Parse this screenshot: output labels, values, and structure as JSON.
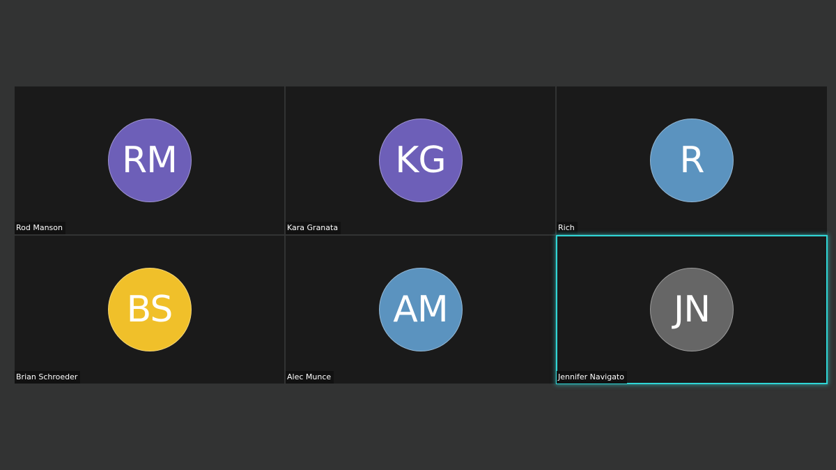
{
  "meeting": {
    "active_speaker_color": "#2fd6d6",
    "background_color": "#323333",
    "participants": [
      {
        "name": "Rod Manson",
        "initials": "RM",
        "avatar_color": "#6d5fb8",
        "speaking": false
      },
      {
        "name": "Kara Granata",
        "initials": "KG",
        "avatar_color": "#6d5fb8",
        "speaking": false
      },
      {
        "name": "Rich",
        "initials": "R",
        "avatar_color": "#5b93bf",
        "speaking": false
      },
      {
        "name": "Brian Schroeder",
        "initials": "BS",
        "avatar_color": "#f0c02a",
        "speaking": false
      },
      {
        "name": "Alec Munce",
        "initials": "AM",
        "avatar_color": "#5b93bf",
        "speaking": false
      },
      {
        "name": "Jennifer Navigato",
        "initials": "JN",
        "avatar_color": "#666666",
        "speaking": true
      }
    ]
  }
}
